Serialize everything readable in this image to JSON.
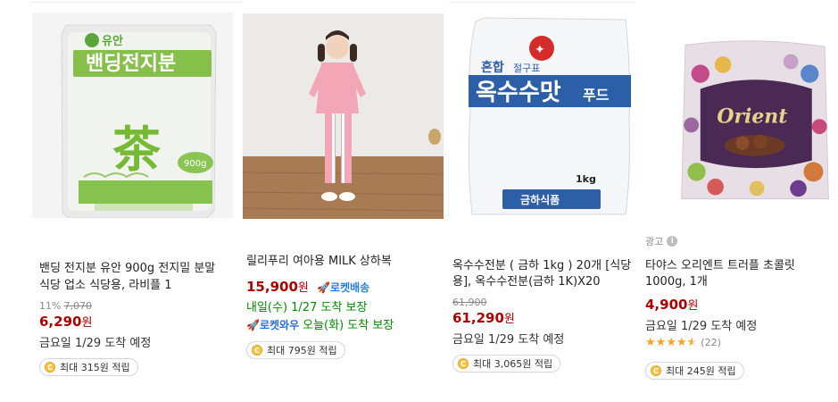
{
  "products": [
    {
      "title_line1": "밴딩 전지분 유안 900g 전지밀 분말",
      "title_line2": "식당 업소 식당용, 라비플 1",
      "discount_rate": "11%",
      "original_price": "7,070",
      "price": "6,290",
      "currency": "원",
      "delivery": "금요일 1/29 도착 예정",
      "reward": "최대 315원 적립",
      "image": {
        "brand": "유안",
        "label": "밴딩전지분",
        "char": "茶",
        "weight": "900g"
      }
    },
    {
      "title_line1": "릴리푸리 여아용 MILK 상하복",
      "price": "15,900",
      "currency": "원",
      "rocket_label": "로켓배송",
      "delivery": "내일(수) 1/27 도착 보장",
      "rocket_wow_label": "로켓와우",
      "delivery_wow": "오늘(화) 도착 보장",
      "reward": "최대 795원 적립"
    },
    {
      "title_line1": "옥수수전분 ( 금하 1kg ) 20개 [식당",
      "title_line2": "용], 옥수수전분(금하 1K)X20",
      "original_price": "61,900",
      "price": "61,290",
      "currency": "원",
      "delivery": "금요일 1/29 도착 예정",
      "reward": "최대 3,065원 적립",
      "image": {
        "top": "혼합 절구표",
        "label": "옥수수맛푸드",
        "weight": "1kg",
        "maker": "금하식품"
      }
    },
    {
      "ad_label": "광고",
      "title_line1": "타야스 오리엔트 트러플 초콜릿",
      "title_line2": "1000g, 1개",
      "price": "4,900",
      "currency": "원",
      "delivery": "금요일 1/29 도착 예정",
      "rating": 4.5,
      "review_count": "(22)",
      "reward": "최대 245원 적립",
      "image": {
        "brand": "Orient"
      }
    }
  ],
  "colors": {
    "price": "#ae0000",
    "green_delivery": "#008c00",
    "rocket_blue": "#2c7be5",
    "star": "#f5a623"
  }
}
